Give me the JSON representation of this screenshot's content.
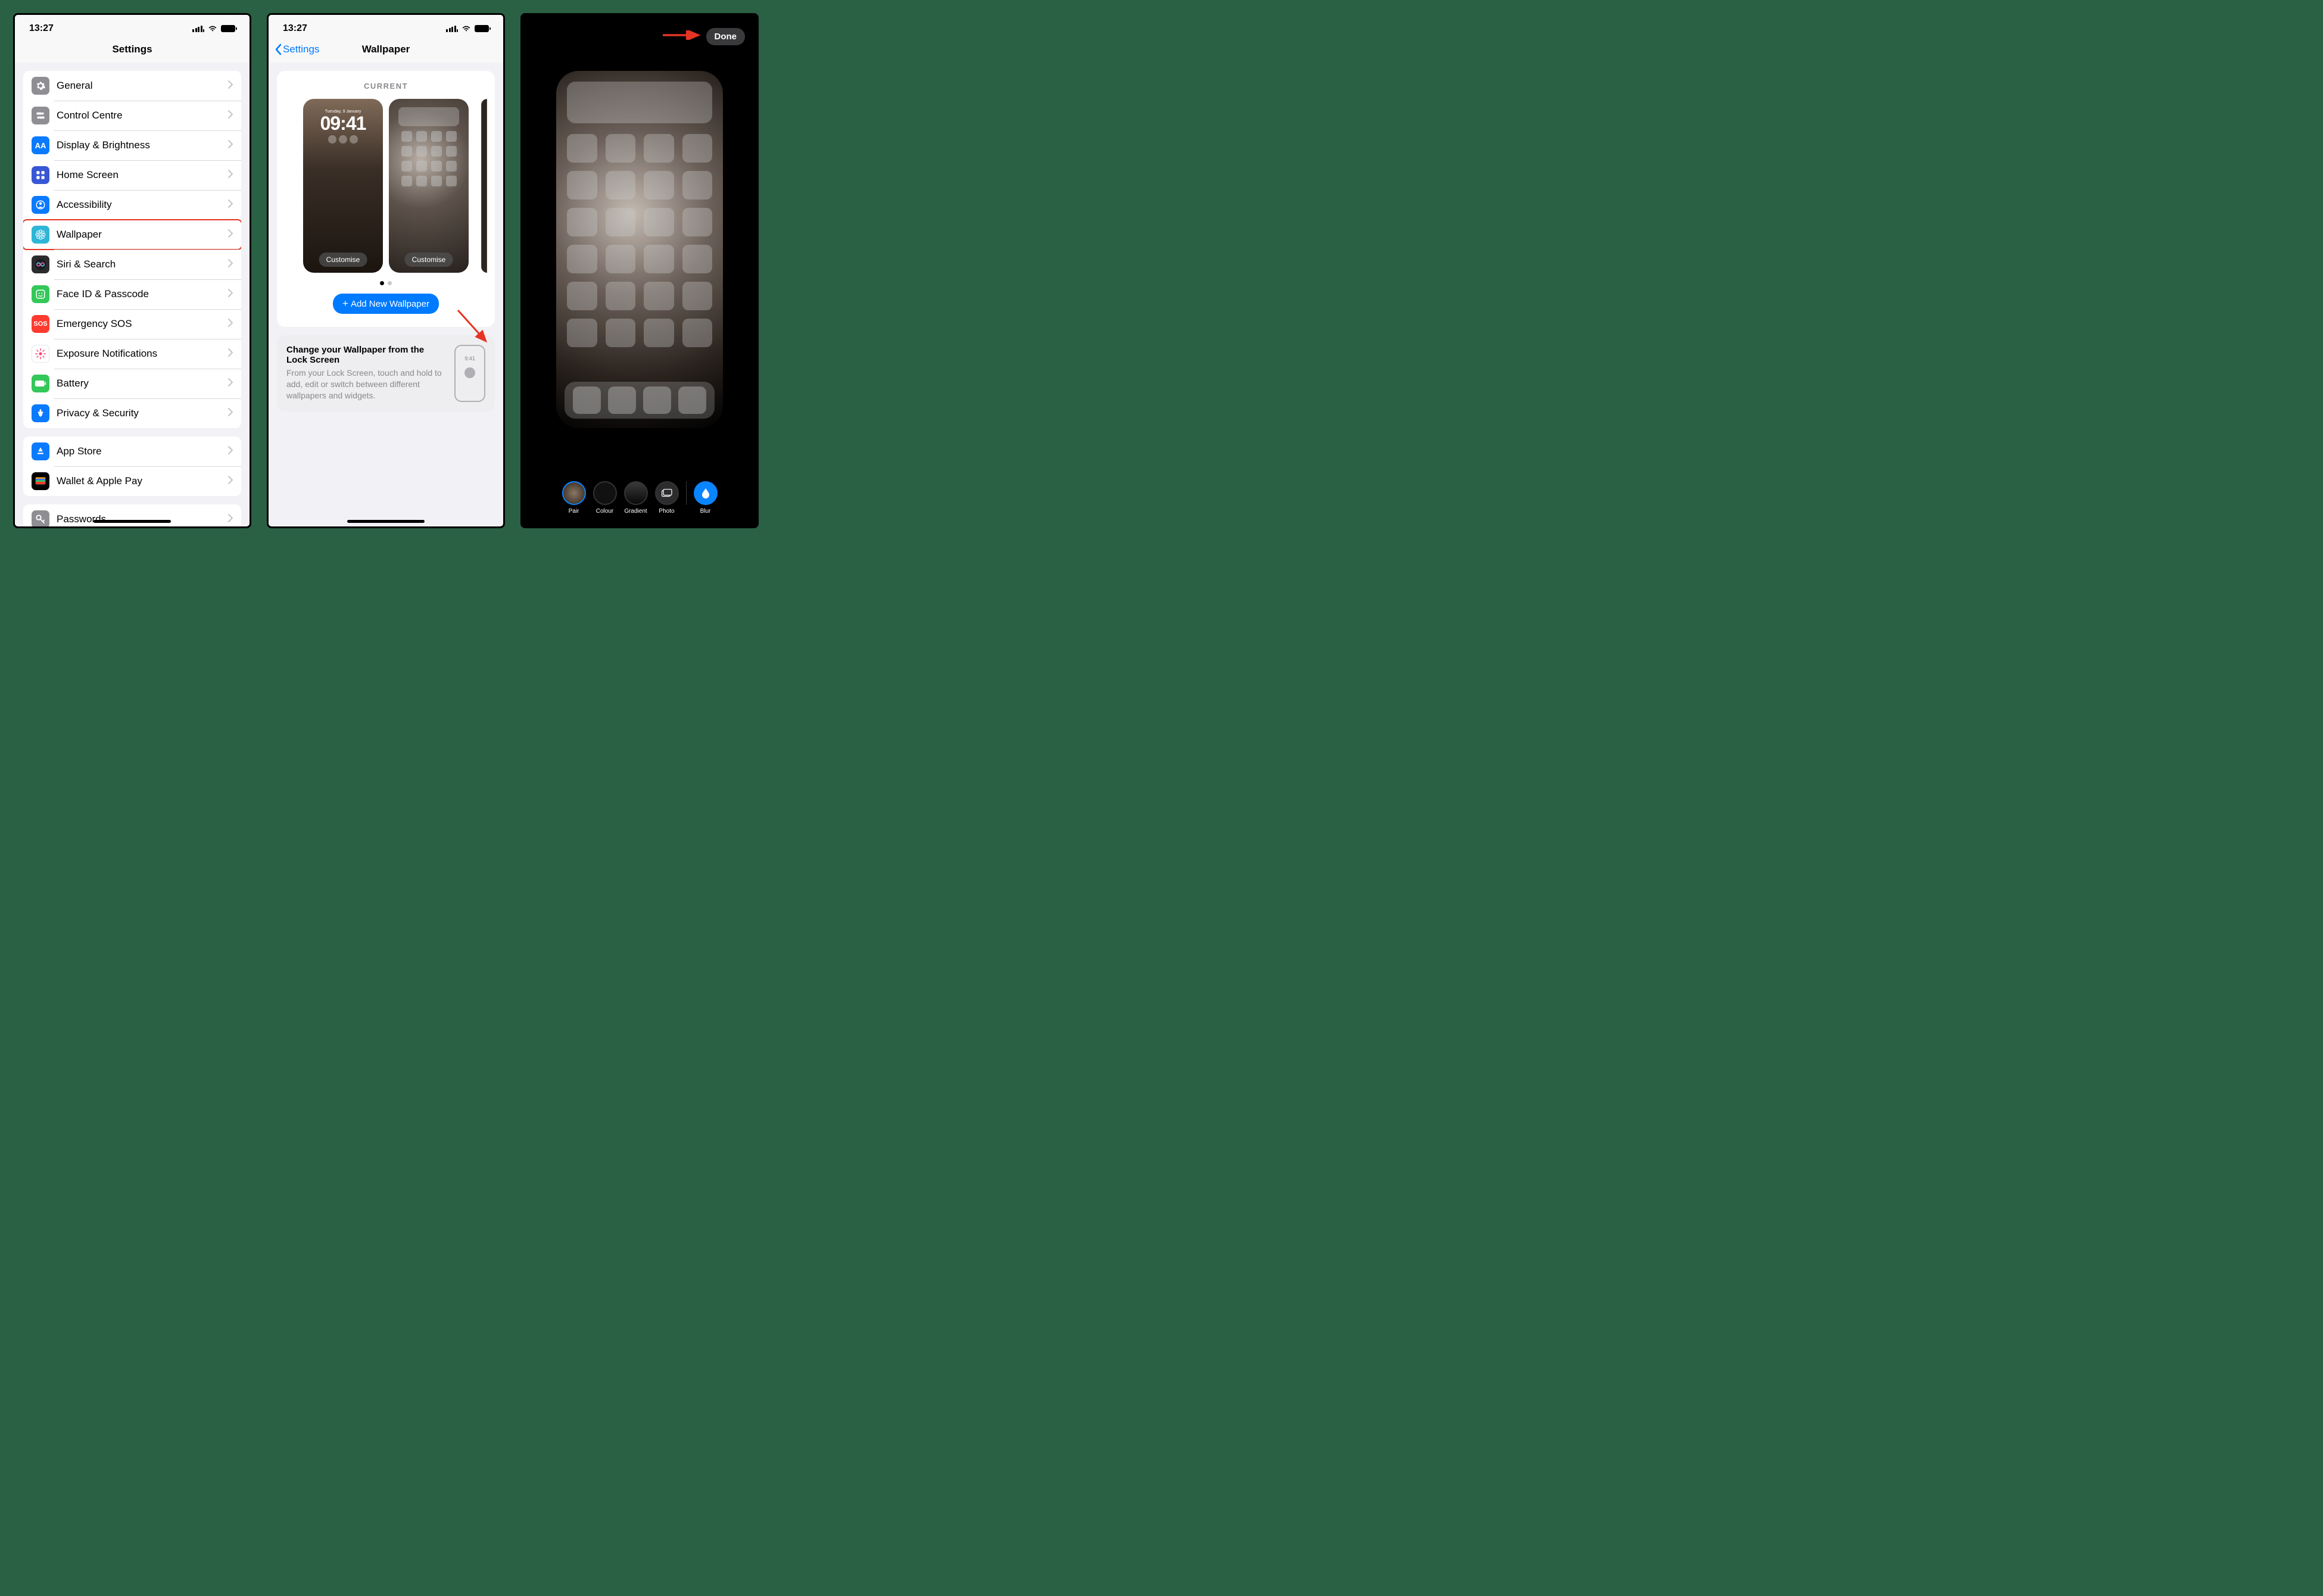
{
  "screen1": {
    "time": "13:27",
    "title": "Settings",
    "rows": [
      {
        "label": "General",
        "color": "#8e8e93",
        "icon": "gear"
      },
      {
        "label": "Control Centre",
        "color": "#8e8e93",
        "icon": "switches"
      },
      {
        "label": "Display & Brightness",
        "color": "#0a7aff",
        "icon": "aa"
      },
      {
        "label": "Home Screen",
        "color": "#3957d4",
        "icon": "grid"
      },
      {
        "label": "Accessibility",
        "color": "#0a7aff",
        "icon": "person"
      },
      {
        "label": "Wallpaper",
        "color": "#2fb5d6",
        "icon": "flower",
        "highlight": true
      },
      {
        "label": "Siri & Search",
        "color": "#2c2c2e",
        "icon": "siri"
      },
      {
        "label": "Face ID & Passcode",
        "color": "#34c759",
        "icon": "face"
      },
      {
        "label": "Emergency SOS",
        "color": "#ff3b30",
        "icon": "sos"
      },
      {
        "label": "Exposure Notifications",
        "color": "#ffffff",
        "icon": "exp",
        "fg": "#ff3b6f"
      },
      {
        "label": "Battery",
        "color": "#34c759",
        "icon": "batt"
      },
      {
        "label": "Privacy & Security",
        "color": "#0a7aff",
        "icon": "hand"
      }
    ],
    "rows2": [
      {
        "label": "App Store",
        "color": "#0a7aff",
        "icon": "astore"
      },
      {
        "label": "Wallet & Apple Pay",
        "color": "#000",
        "icon": "wallet"
      }
    ],
    "rows3": [
      {
        "label": "Passwords",
        "color": "#8e8e93",
        "icon": "key"
      }
    ]
  },
  "screen2": {
    "time": "13:27",
    "back": "Settings",
    "title": "Wallpaper",
    "current_label": "CURRENT",
    "customise": "Customise",
    "lock_day": "Tuesday, 9 January",
    "lock_time": "09:41",
    "add_new": "Add New Wallpaper",
    "info_title": "Change your Wallpaper from the Lock Screen",
    "info_body": "From your Lock Screen, touch and hold to add, edit or switch between different wallpapers and widgets.",
    "mini_time": "9:41"
  },
  "screen3": {
    "done": "Done",
    "opts": [
      "Pair",
      "Colour",
      "Gradient",
      "Photo"
    ],
    "blur": "Blur"
  }
}
